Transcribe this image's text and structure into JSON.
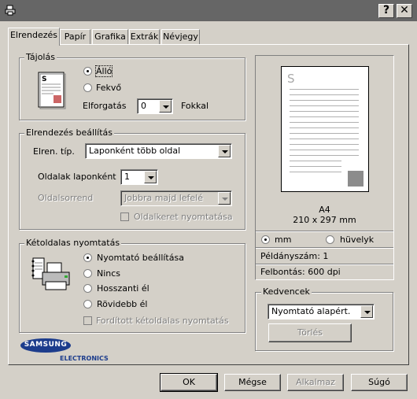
{
  "titlebar": {
    "help_glyph": "?",
    "close_glyph": "✕"
  },
  "tabs": [
    "Elrendezés",
    "Papír",
    "Grafika",
    "Extrák",
    "Névjegy"
  ],
  "orientation": {
    "legend": "Tájolás",
    "portrait": "Álló",
    "landscape": "Fekvő",
    "rotation_label": "Elforgatás",
    "rotation_value": "0",
    "rotation_unit": "Fokkal"
  },
  "layout": {
    "legend": "Elrendezés beállítás",
    "type_label": "Elren. típ.",
    "type_value": "Laponként több oldal",
    "pages_label": "Oldalak laponként",
    "pages_value": "1",
    "order_label": "Oldalsorrend",
    "order_value": "Jobbra majd lefelé",
    "border_label": "Oldalkeret nyomtatása"
  },
  "duplex": {
    "legend": "Kétoldalas nyomtatás",
    "options": [
      "Nyomtató beállítása",
      "Nincs",
      "Hosszanti él",
      "Rövidebb él"
    ],
    "reverse_label": "Fordított kétoldalas nyomtatás"
  },
  "logo": {
    "brand": "SAMSUNG",
    "sub": "ELECTRONICS"
  },
  "preview": {
    "page_glyph": "S",
    "paper_name": "A4",
    "paper_size": "210 x 297 mm",
    "unit_mm": "mm",
    "unit_inch": "hüvelyk",
    "copies": "Példányszám: 1",
    "resolution": "Felbontás: 600 dpi"
  },
  "favorites": {
    "legend": "Kedvencek",
    "value": "Nyomtató alapért.",
    "delete_label": "Törlés"
  },
  "buttons": {
    "ok": "OK",
    "cancel": "Mégse",
    "apply": "Alkalmaz",
    "help": "Súgó"
  },
  "colors": {
    "titlebar": "#666666",
    "face": "#d4d0c8",
    "thumb_gray": "#8c8c8c"
  }
}
